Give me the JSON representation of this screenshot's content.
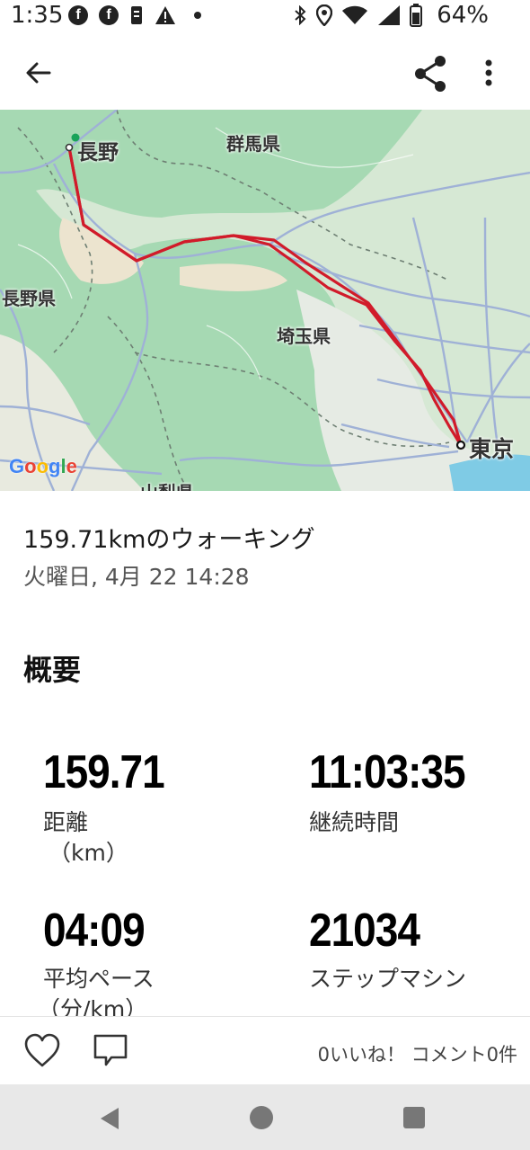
{
  "status": {
    "time": "1:35",
    "battery": "64%",
    "icons": [
      "facebook-icon",
      "facebook-icon",
      "sim-icon",
      "warning-icon",
      "dot-icon",
      "bluetooth-icon",
      "location-icon",
      "wifi-icon",
      "signal-icon",
      "battery-icon"
    ]
  },
  "map": {
    "labels": {
      "nagano_city": "長野",
      "gunma": "群馬県",
      "nagano_pref": "長野県",
      "saitama": "埼玉県",
      "tokyo": "東京",
      "yamanashi": "山梨県"
    },
    "logo": "Google",
    "route_color": "#d11b2a"
  },
  "activity": {
    "title": "159.71kmのウォーキング",
    "date": "火曜日, 4月 22 14:28"
  },
  "summary": {
    "heading": "概要",
    "metrics": [
      {
        "value": "159.71",
        "label": "距離",
        "unit": "（km）"
      },
      {
        "value": "11:03:35",
        "label": "継続時間",
        "unit": ""
      },
      {
        "value": "04:09",
        "label": "平均ペース",
        "unit": "（分/km）"
      },
      {
        "value": "21034",
        "label": "ステップマシン",
        "unit": ""
      }
    ]
  },
  "actions": {
    "counts": "0いいね！ コメント0件"
  }
}
